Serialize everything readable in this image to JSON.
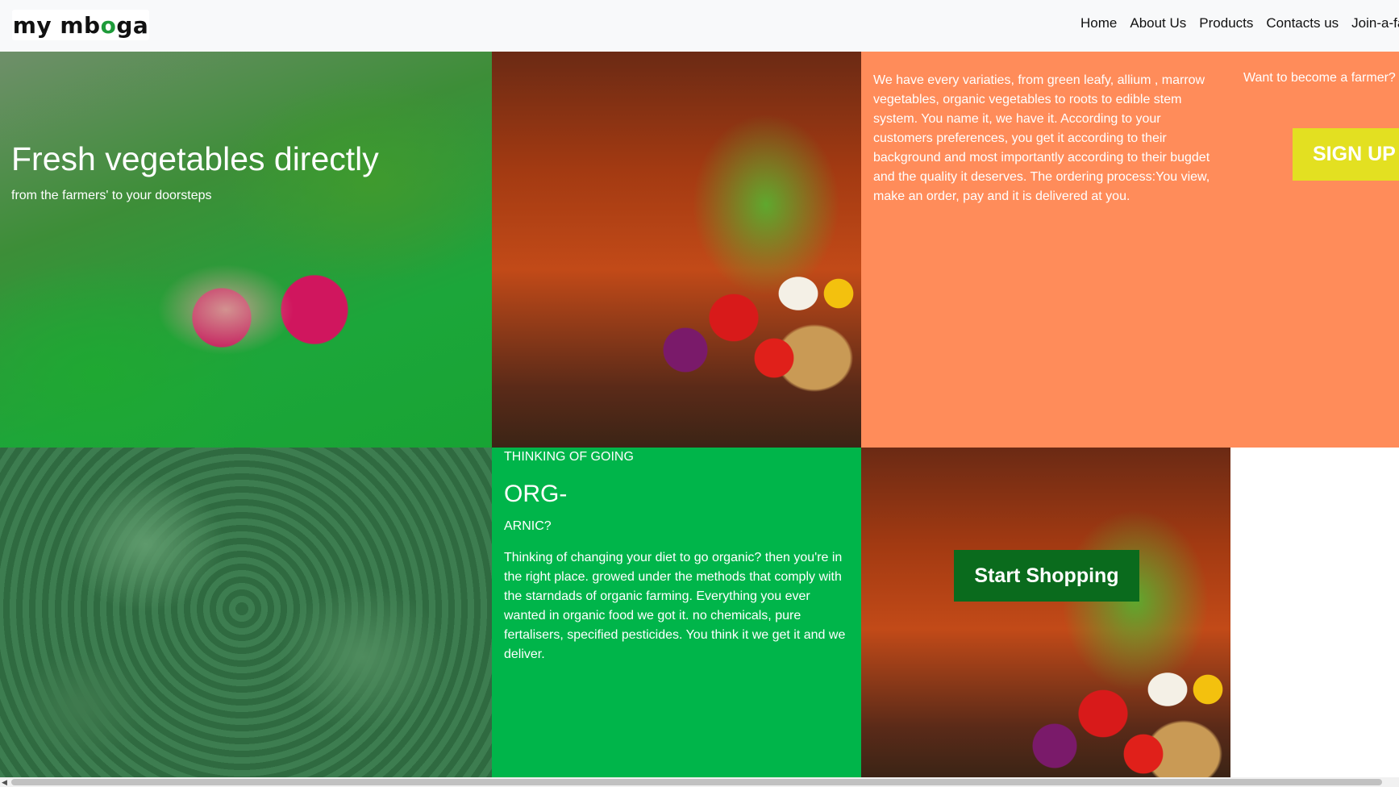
{
  "brand": {
    "logo_alt": "my mboga",
    "logo_part1": "my mb",
    "logo_o": "o",
    "logo_part2": "ga"
  },
  "nav": {
    "items": [
      "Home",
      "About Us",
      "Products",
      "Contacts us",
      "Join-a-farm"
    ]
  },
  "hero": {
    "title": "Fresh vegetables directly",
    "subtitle": "from the farmers' to your doorsteps"
  },
  "info": {
    "text": "We have every variaties, from green leafy, allium , marrow vegetables, organic vegetables to roots to edible stem system. You name it, we have it. According to your customers preferences, you get it according to their background and most importantly according to their bugdet and the quality it deserves. The ordering process:You view, make an order, pay and it is delivered at you.",
    "farmer_question": "Want to become a farmer?",
    "signup_label": "SIGN UP"
  },
  "organic": {
    "kicker": "THINKING OF GOING",
    "heading": "ORG-",
    "heading_tail": "ARNIC?",
    "body": "Thinking of changing your diet to go organic? then you're in the right place. growed under the methods that comply with the starndads of organic farming. Everything you ever wanted in organic food we got it. no chemicals, pure fertalisers, specified pesticides. You think it we get it and we deliver."
  },
  "shop": {
    "button_label": "Start Shopping"
  },
  "colors": {
    "orange_panel": "#ff8c5a",
    "green_panel": "#00b54a",
    "signup_bg": "#e3e021",
    "shop_btn_bg": "#0a6b1d"
  }
}
